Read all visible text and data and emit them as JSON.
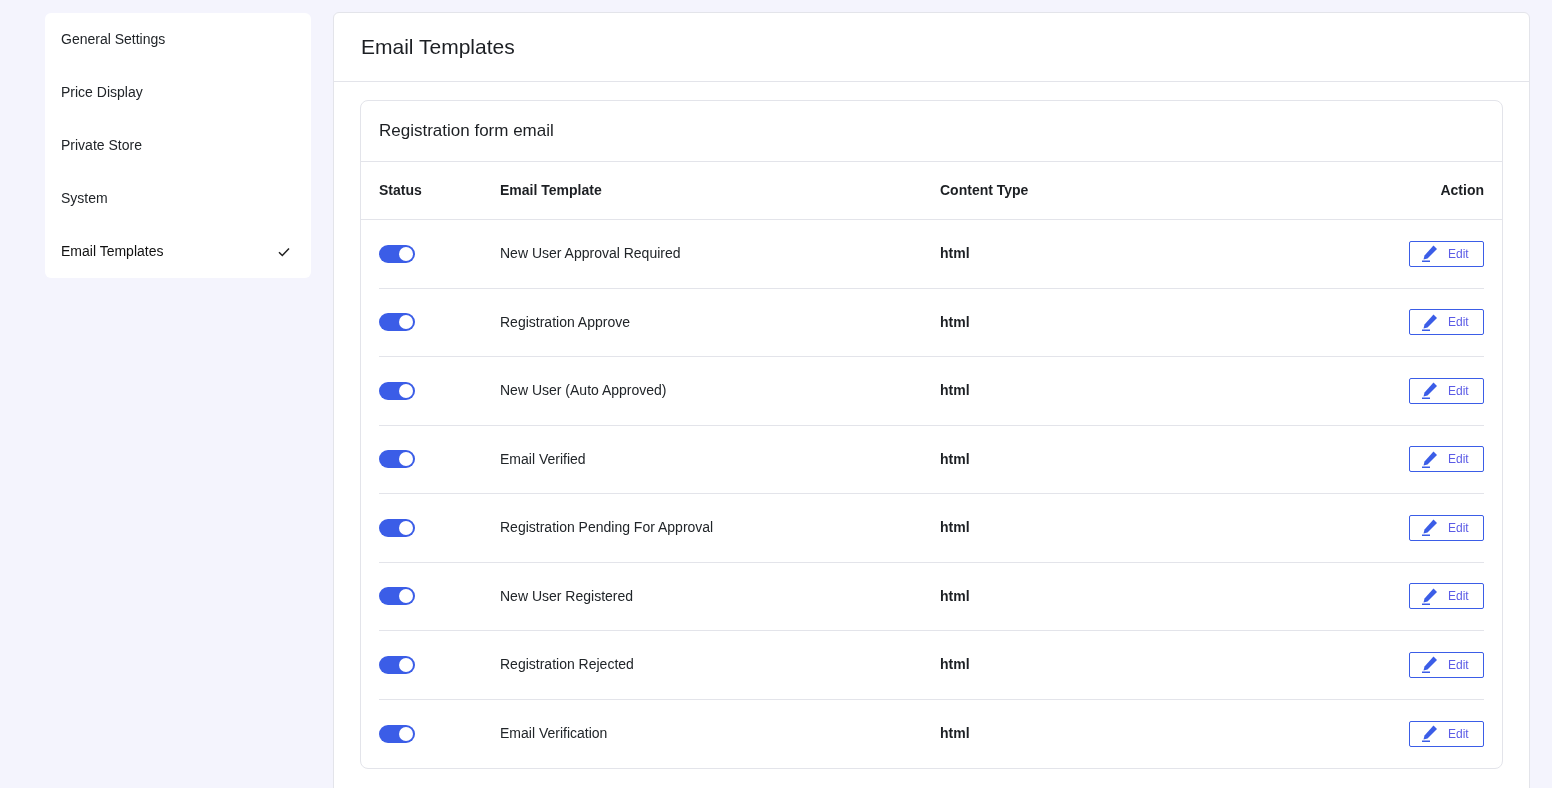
{
  "sidebar": {
    "items": [
      {
        "label": "General Settings",
        "selected": false
      },
      {
        "label": "Price Display",
        "selected": false
      },
      {
        "label": "Private Store",
        "selected": false
      },
      {
        "label": "System",
        "selected": false
      },
      {
        "label": "Email Templates",
        "selected": true
      }
    ]
  },
  "panel": {
    "title": "Email Templates"
  },
  "section": {
    "title": "Registration form email",
    "columns": [
      "Status",
      "Email Template",
      "Content Type",
      "Action"
    ],
    "rows": [
      {
        "on": true,
        "template": "New User Approval Required",
        "content_type": "html",
        "action": "Edit"
      },
      {
        "on": true,
        "template": "Registration Approve",
        "content_type": "html",
        "action": "Edit"
      },
      {
        "on": true,
        "template": "New User (Auto Approved)",
        "content_type": "html",
        "action": "Edit"
      },
      {
        "on": true,
        "template": "Email Verified",
        "content_type": "html",
        "action": "Edit"
      },
      {
        "on": true,
        "template": "Registration Pending For Approval",
        "content_type": "html",
        "action": "Edit"
      },
      {
        "on": true,
        "template": "New User Registered",
        "content_type": "html",
        "action": "Edit"
      },
      {
        "on": true,
        "template": "Registration Rejected",
        "content_type": "html",
        "action": "Edit"
      },
      {
        "on": true,
        "template": "Email Verification",
        "content_type": "html",
        "action": "Edit"
      }
    ]
  }
}
